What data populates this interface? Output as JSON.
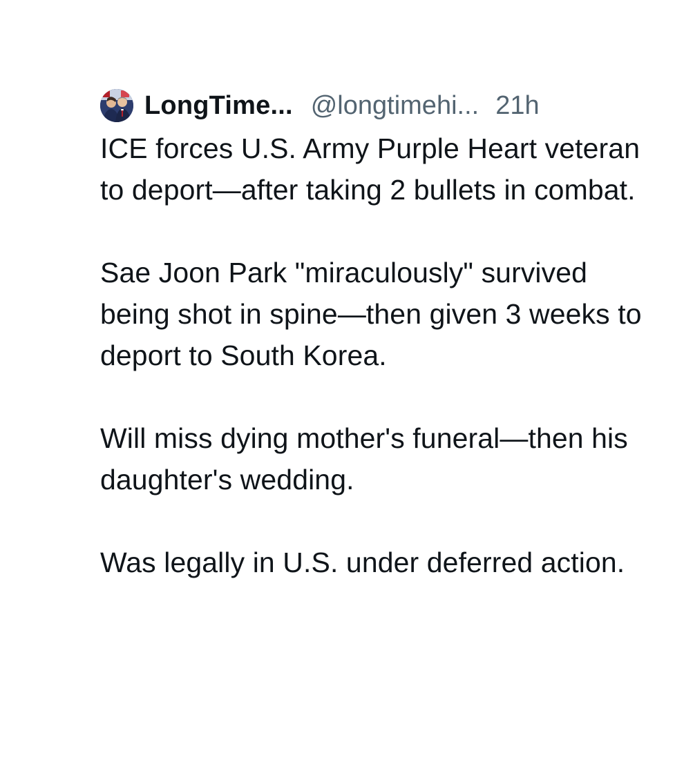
{
  "post": {
    "author": {
      "display_name": "LongTime...",
      "handle": "@longtimehi...",
      "avatar_icon": "profile-photo-avatar"
    },
    "timestamp": "21h",
    "paragraphs": [
      "ICE forces U.S. Army Purple Heart veteran to deport—after taking 2 bullets in combat.",
      "Sae Joon Park \"miraculously\" survived being shot in spine—then given 3 weeks to deport to South Korea.",
      "Will miss dying mother's funeral—then his daughter's wedding.",
      "Was legally in U.S. under deferred action."
    ]
  },
  "colors": {
    "text_primary": "#0f1419",
    "text_secondary": "#536471",
    "background": "#ffffff"
  }
}
